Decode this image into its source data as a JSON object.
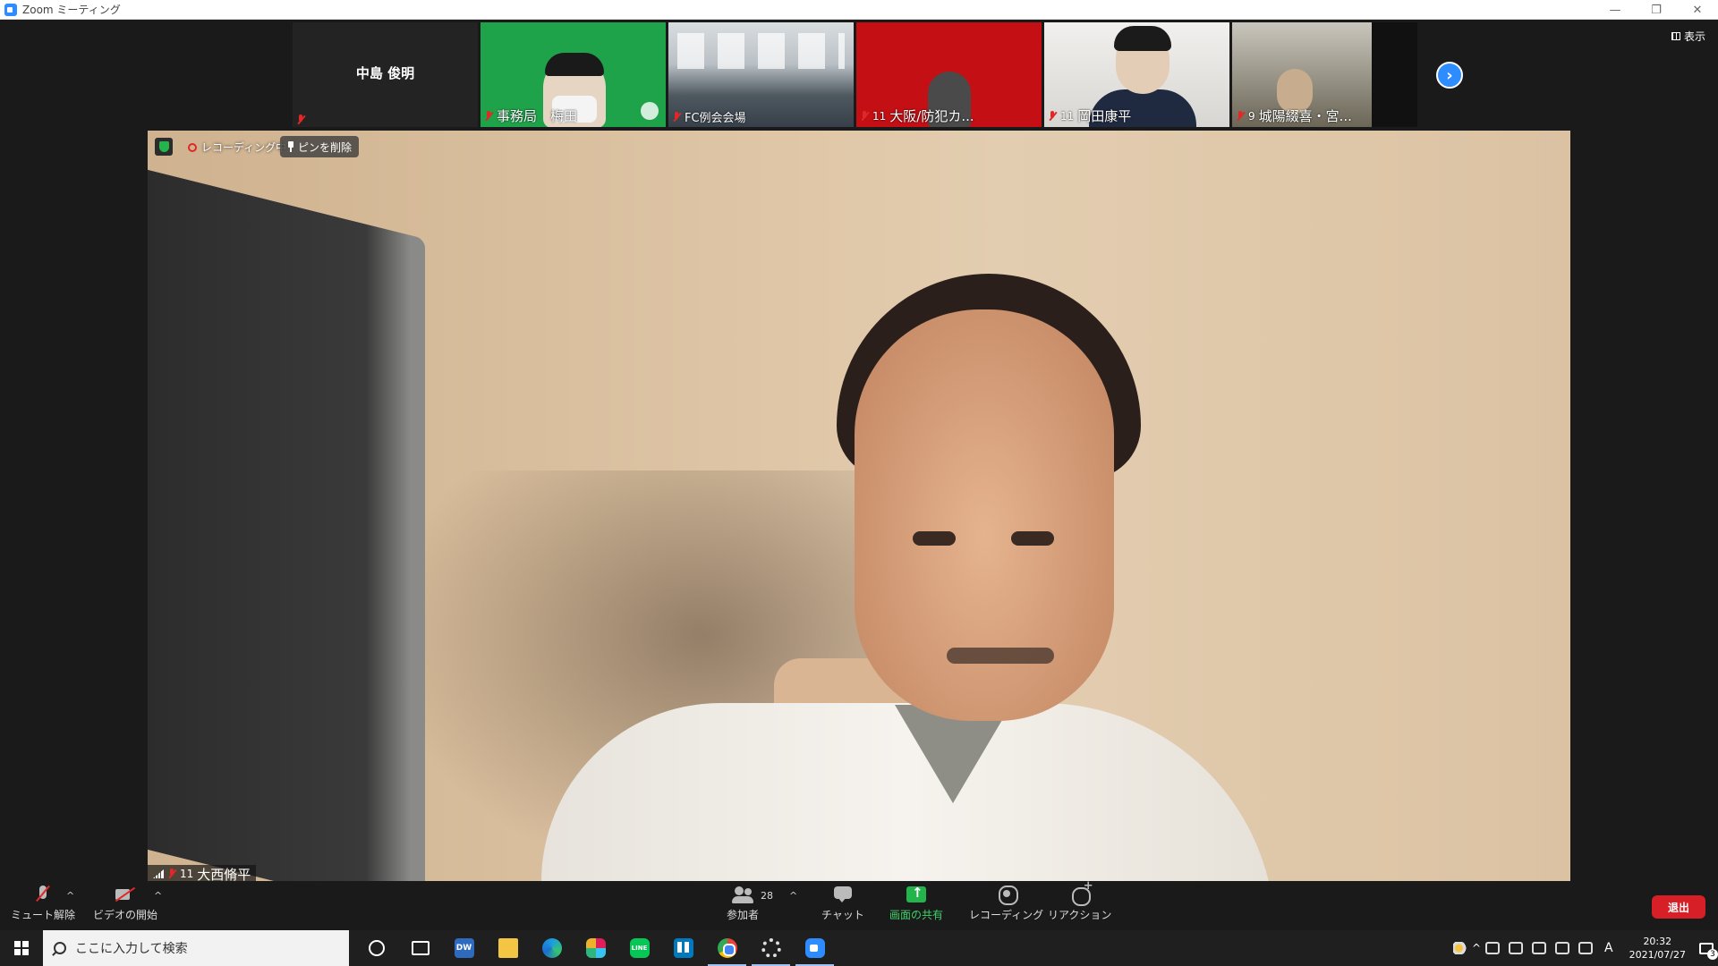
{
  "window": {
    "title": "Zoom ミーティング",
    "controls": [
      "—",
      "❐",
      "✕"
    ]
  },
  "thumbnails": [
    {
      "name": "中島 俊明",
      "count": "",
      "muted": true,
      "style": "nameonly"
    },
    {
      "name": "事務局　梅田",
      "count": "",
      "muted": true,
      "style": "green"
    },
    {
      "name": "FC例会会場",
      "count": "",
      "muted": true,
      "style": "hall"
    },
    {
      "name": "大阪/防犯カ...",
      "count": "11",
      "muted": true,
      "style": "red"
    },
    {
      "name": "岡田康平",
      "count": "11",
      "muted": true,
      "style": "room"
    },
    {
      "name": "城陽綴喜・宮...",
      "count": "9",
      "muted": true,
      "style": "dim"
    }
  ],
  "view_button": {
    "label": "表示",
    "icon": "grid-icon"
  },
  "main_video": {
    "recording_label": "レコーディング中",
    "unpin_label": "ピンを削除",
    "speaker": {
      "count": "11",
      "name": "大西脩平",
      "muted": true
    }
  },
  "toolbar": {
    "unmute_label": "ミュート解除",
    "video_label": "ビデオの開始",
    "participants_label": "参加者",
    "participants_count": "28",
    "chat_label": "チャット",
    "share_label": "画面の共有",
    "record_label": "レコーディング",
    "reaction_label": "リアクション",
    "leave_label": "退出",
    "share_color": "#23b54b",
    "leave_color": "#d71f27"
  },
  "taskbar": {
    "search_placeholder": "ここに入力して検索",
    "apps": [
      "cortana-icon",
      "task-view-icon",
      "dreamweaver-icon",
      "file-explorer-icon",
      "edge-icon",
      "slack-icon",
      "line-icon",
      "trello-icon",
      "chrome-icon",
      "settings-icon",
      "zoom-icon"
    ],
    "dw_text": "DW",
    "line_text": "LINE",
    "ime_indicator": "A",
    "time": "20:32",
    "date": "2021/07/27",
    "notification_count": "3"
  }
}
